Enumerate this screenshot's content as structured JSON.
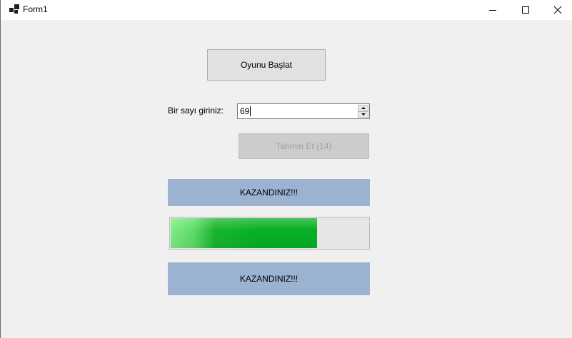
{
  "window": {
    "title": "Form1"
  },
  "icons": {
    "app": "app-window-icon",
    "minimize": "minimize-icon",
    "maximize": "maximize-icon",
    "close": "close-icon",
    "spin_up": "chevron-up-icon",
    "spin_down": "chevron-down-icon"
  },
  "start_button": {
    "label": "Oyunu Başlat"
  },
  "number_input": {
    "label": "Bir sayı giriniz:",
    "value": "69"
  },
  "guess_button": {
    "label": "Tahmin Et (14)",
    "enabled": false
  },
  "result_label_top": {
    "text": "KAZANDINIZ!!!"
  },
  "progress": {
    "percent": 74
  },
  "result_label_bottom": {
    "text": "KAZANDINIZ!!!"
  },
  "colors": {
    "form_background": "#f0f0f0",
    "result_label_background": "#9bb3d1",
    "progress_fill": "#06b025",
    "disabled_text": "#a0a0a0"
  }
}
